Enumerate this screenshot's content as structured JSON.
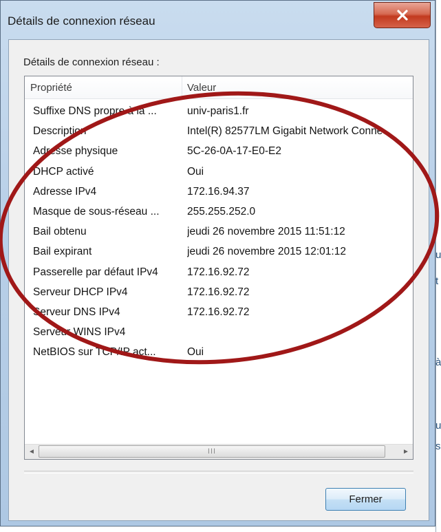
{
  "window": {
    "title": "Détails de connexion réseau",
    "close_glyph": "x"
  },
  "group_label": "Détails de connexion réseau :",
  "list": {
    "columns": [
      "Propriété",
      "Valeur"
    ],
    "rows": [
      {
        "key": "Suffixe DNS propre à la ...",
        "value": "univ-paris1.fr"
      },
      {
        "key": "Description",
        "value": "Intel(R) 82577LM Gigabit Network Conne"
      },
      {
        "key": "Adresse physique",
        "value": "5C-26-0A-17-E0-E2"
      },
      {
        "key": "DHCP activé",
        "value": "Oui"
      },
      {
        "key": "Adresse IPv4",
        "value": "172.16.94.37"
      },
      {
        "key": "Masque de sous-réseau ...",
        "value": "255.255.252.0"
      },
      {
        "key": "Bail obtenu",
        "value": "jeudi 26 novembre 2015 11:51:12"
      },
      {
        "key": "Bail expirant",
        "value": "jeudi 26 novembre 2015 12:01:12"
      },
      {
        "key": "Passerelle par défaut IPv4",
        "value": "172.16.92.72"
      },
      {
        "key": "Serveur DHCP IPv4",
        "value": "172.16.92.72"
      },
      {
        "key": "Serveur DNS IPv4",
        "value": "172.16.92.72"
      },
      {
        "key": "Serveur WINS IPv4",
        "value": ""
      },
      {
        "key": "NetBIOS sur TCP/IP act...",
        "value": "Oui"
      }
    ]
  },
  "scrollbar": {
    "left_arrow": "◄",
    "right_arrow": "►",
    "grip": "III"
  },
  "buttons": {
    "close_label": "Fermer"
  },
  "background_window_glyphs": [
    "u",
    "t",
    "à",
    "u",
    "s"
  ],
  "colors": {
    "annotation": "#a01818",
    "button_border": "#3c7fb1"
  },
  "icons": {
    "close": "close-icon",
    "scroll_left": "arrow-left-icon",
    "scroll_right": "arrow-right-icon"
  }
}
